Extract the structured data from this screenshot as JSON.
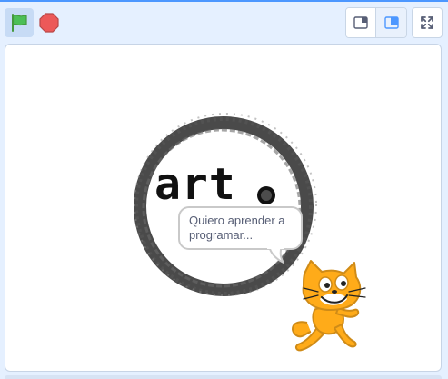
{
  "controls": {
    "green_flag_icon": "green-flag-icon",
    "stop_icon": "stop-sign-icon",
    "small_stage_icon": "small-stage-layout-icon",
    "normal_stage_icon": "normal-stage-layout-icon",
    "fullscreen_icon": "fullscreen-icon"
  },
  "stage": {
    "backdrop_text": "art",
    "speech_bubble": "Quiero aprender a programar...",
    "sprite": "cat-sprite"
  },
  "colors": {
    "accent": "#4c97ff",
    "flag_green": "#4cbf56",
    "stop_red": "#ec5959",
    "cat_orange": "#ffab19",
    "speech_text": "#575e75"
  }
}
